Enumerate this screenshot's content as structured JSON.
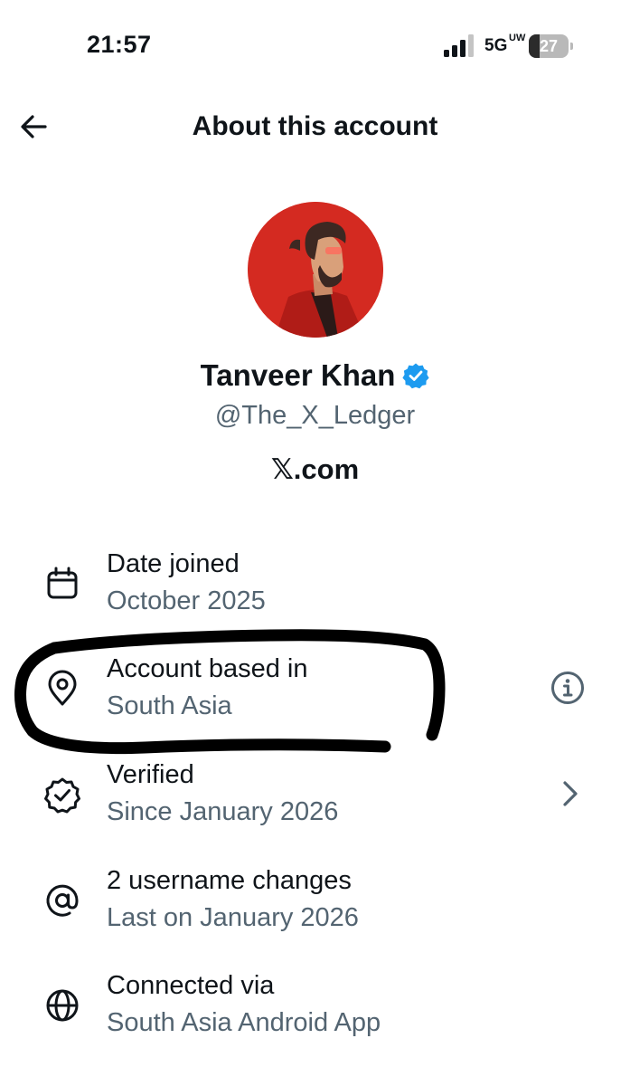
{
  "status_bar": {
    "time": "21:57",
    "network": "5G",
    "network_sup": "UW",
    "battery_percent": 27,
    "battery_label": "27"
  },
  "header": {
    "title": "About this account",
    "back_icon": "arrow-left-icon"
  },
  "profile": {
    "name": "Tanveer Khan",
    "handle": "@The_X_Ledger",
    "site": "𝕏.com",
    "verified": true,
    "badge_color": "#1d9bf0"
  },
  "rows": [
    {
      "icon": "calendar-icon",
      "title": "Date joined",
      "value": "October 2025",
      "trailing": null
    },
    {
      "icon": "location-pin-icon",
      "title": "Account based in",
      "value": "South Asia",
      "trailing": "info-icon"
    },
    {
      "icon": "verified-check-icon",
      "title": "Verified",
      "value": "Since January 2026",
      "trailing": "chevron-right-icon"
    },
    {
      "icon": "at-sign-icon",
      "title": "2 username changes",
      "value": "Last on January 2026",
      "trailing": null
    },
    {
      "icon": "globe-icon",
      "title": "Connected via",
      "value": "South Asia Android App",
      "trailing": null
    }
  ],
  "colors": {
    "text_primary": "#0f1419",
    "text_secondary": "#536471",
    "avatar_background": "#d42a21",
    "annotation_ink": "#000000"
  }
}
